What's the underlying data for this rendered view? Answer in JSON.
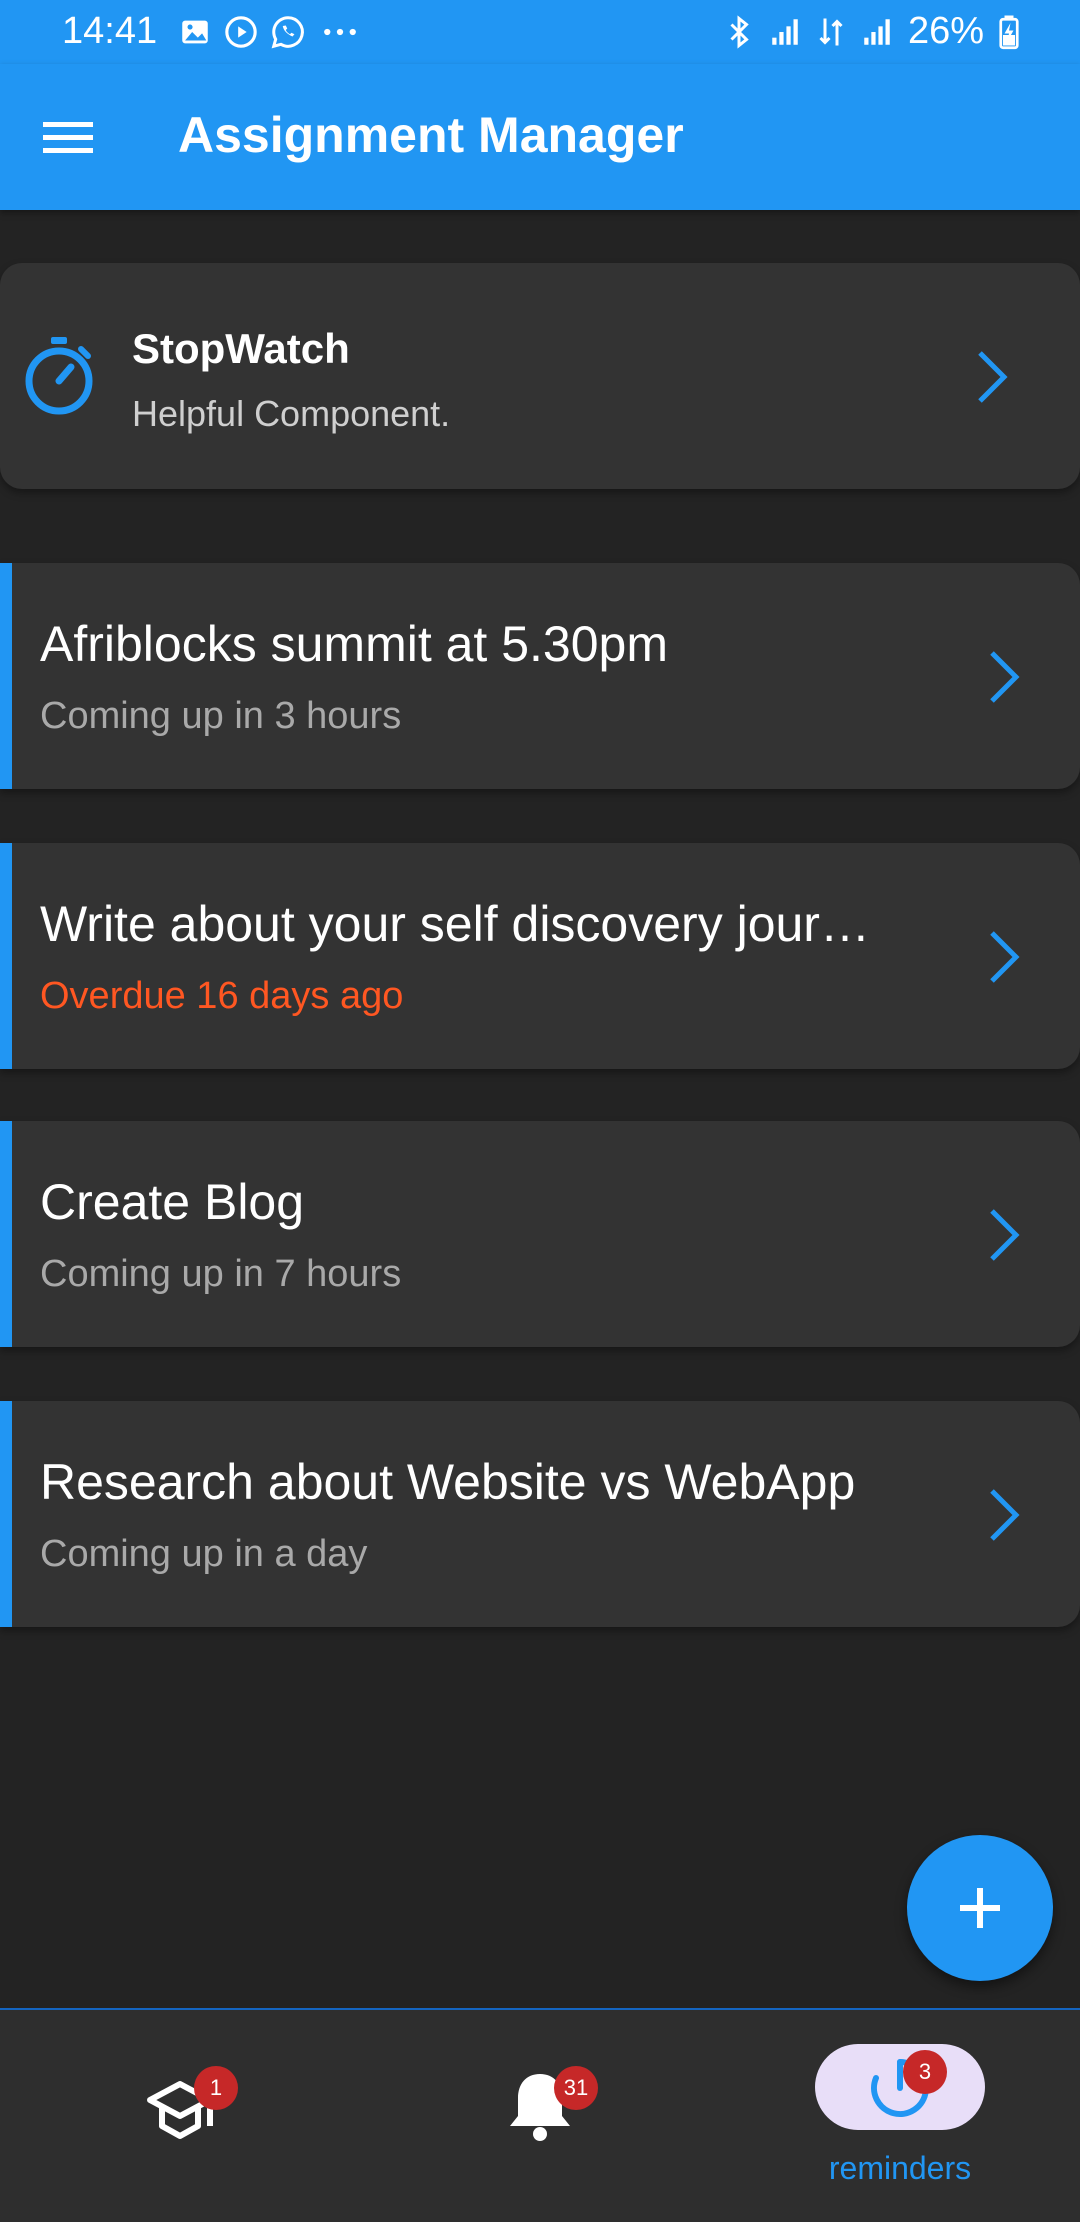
{
  "status_bar": {
    "time": "14:41",
    "battery": "26%"
  },
  "app_bar": {
    "title": "Assignment Manager"
  },
  "stopwatch_card": {
    "title": "StopWatch",
    "subtitle": "Helpful Component."
  },
  "tasks": [
    {
      "title": "Afriblocks summit at 5.30pm",
      "status": "Coming up in 3 hours"
    },
    {
      "title": "Write about your self discovery jour…",
      "status": "Overdue 16 days ago"
    },
    {
      "title": "Create Blog",
      "status": "Coming up in 7 hours"
    },
    {
      "title": "Research about Website vs WebApp",
      "status": "Coming up in a day"
    }
  ],
  "bottom_nav": {
    "assignments_badge": "1",
    "notifications_badge": "31",
    "reminders_badge": "3",
    "reminders_label": "reminders"
  },
  "colors": {
    "accent": "#2196f3",
    "background": "#232323",
    "card": "#333333",
    "overdue": "#ff5722",
    "badge": "#c62828"
  },
  "icons": {
    "menu": "hamburger-menu-icon",
    "stopwatch": "stopwatch-icon",
    "chevron": "chevron-right-icon",
    "fab": "plus-icon",
    "assignments": "graduation-cap-icon",
    "notifications": "bell-icon",
    "reminders": "timer-icon"
  }
}
